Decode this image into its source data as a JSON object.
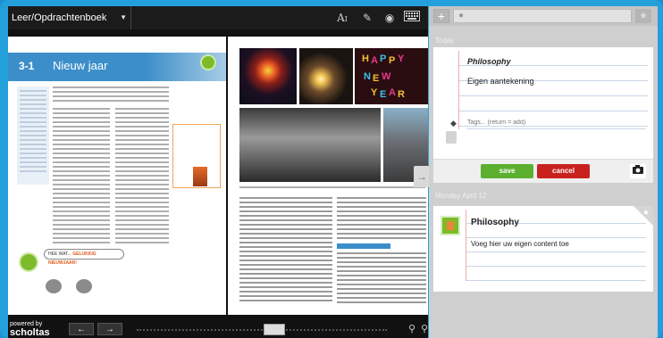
{
  "viewer": {
    "book_title": "Leer/Opdrachtenboek",
    "toolbar_icons": [
      "text-size-icon",
      "pen-icon",
      "eye-icon",
      "keyboard-icon"
    ]
  },
  "page_left": {
    "chapter_number": "3-1",
    "chapter_title": "Nieuw jaar",
    "speech_text": "HEE WAT...",
    "speech_highlight": "GELUKKIG NIEUWJAAR!"
  },
  "navigation": {
    "powered_by": "powered by",
    "brand": "scholtas",
    "prev_label": "←",
    "next_label": "→"
  },
  "notes": {
    "date_1": "Today",
    "date_2": "Monday April 12",
    "editor": {
      "title": "Philosophy",
      "body": "Eigen aantekening",
      "tags_placeholder": "Tags... (return = add)",
      "save_label": "save",
      "cancel_label": "cancel"
    },
    "card": {
      "title": "Philosophy",
      "body": "Voeg hier uw eigen content toe"
    }
  },
  "colors": {
    "frame_blue": "#23a0dc",
    "chapter_blue": "#3c8ec9",
    "save_green": "#5bb030",
    "cancel_red": "#c9211e",
    "note_green": "#7dbb2a"
  }
}
